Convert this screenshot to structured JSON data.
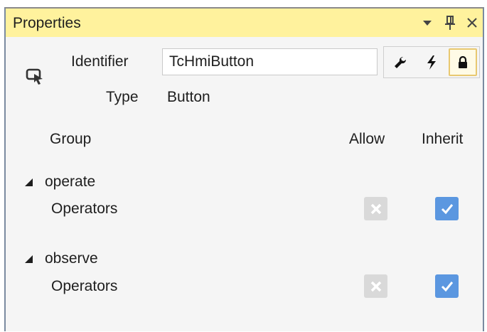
{
  "panel": {
    "title": "Properties",
    "buttons": [
      "dropdown-icon",
      "pin-icon",
      "close-icon"
    ]
  },
  "identifier": {
    "label": "Identifier",
    "value": "TcHmiButton"
  },
  "type": {
    "label": "Type",
    "value": "Button"
  },
  "toolbar": {
    "tools": [
      "wrench-icon",
      "lightning-icon",
      "lock-icon"
    ],
    "active_tool": "lock-icon"
  },
  "columns": {
    "group": "Group",
    "allow": "Allow",
    "inherit": "Inherit"
  },
  "groups": [
    {
      "name": "operate",
      "expanded": true,
      "rows": [
        {
          "label": "Operators",
          "allow": "denied",
          "inherit": true
        }
      ]
    },
    {
      "name": "observe",
      "expanded": true,
      "rows": [
        {
          "label": "Operators",
          "allow": "denied",
          "inherit": true
        }
      ]
    }
  ],
  "colors": {
    "title_bar": "#fff29d",
    "checkbox_checked": "#5b97e0",
    "checkbox_disabled": "#d9d9d9",
    "active_tool_border": "#e8c870"
  }
}
